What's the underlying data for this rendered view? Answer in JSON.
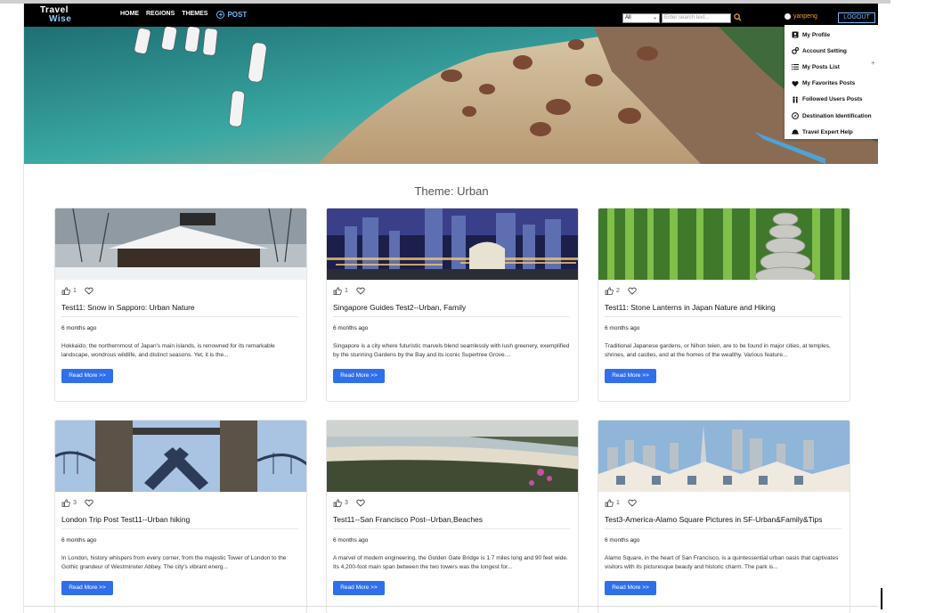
{
  "nav": {
    "logo_line1": "Travel",
    "logo_line2": "Wise",
    "links": [
      "HOME",
      "REGIONS",
      "THEMES"
    ],
    "post_label": "POST",
    "select_value": "All",
    "search_placeholder": "Enter search text...",
    "username": "yanpeng",
    "logout_label": "LOGOUT"
  },
  "user_menu": [
    {
      "label": "My Profile",
      "icon": "profile-icon"
    },
    {
      "label": "Account Setting",
      "icon": "gears-icon"
    },
    {
      "label": "My Posts List",
      "icon": "list-icon"
    },
    {
      "label": "My Favorites Posts",
      "icon": "heart-icon"
    },
    {
      "label": "Followed Users Posts",
      "icon": "followed-users-icon"
    },
    {
      "label": "Destination Identification",
      "icon": "compass-icon"
    },
    {
      "label": "Travel Expert Help",
      "icon": "expert-hat-icon"
    }
  ],
  "page_title": "Theme: Urban",
  "read_more_label": "Read More >>",
  "cards": [
    {
      "likes": "1",
      "title": "Test11: Snow in Sapporo: Urban Nature",
      "time": "6 months ago",
      "desc": "Hokkaido, the northernmost of Japan's main islands, is renowned for its remarkable landscape, wondrous wildlife, and distinct seasons. Yet, it is the...",
      "image": "snowy-house"
    },
    {
      "likes": "1",
      "title": "Singapore Guides Test2--Urban, Family",
      "time": "6 months ago",
      "desc": "Singapore is a city where futuristic marvels blend seamlessly with lush greenery, exemplified by the stunning Gardens by the Bay and its iconic Supertree Grove....",
      "image": "night-city"
    },
    {
      "likes": "2",
      "title": "Test11: Stone Lanterns in Japan Nature and Hiking",
      "time": "6 months ago",
      "desc": "Traditional Japanese gardens, or Nihon teien, are to be found in major cities, at temples, shrines, and castles, and at the homes of the wealthy. Various feature...",
      "image": "bamboo-stones"
    },
    {
      "likes": "3",
      "title": "London Trip Post Test11--Urban hiking",
      "time": "6 months ago",
      "desc": "In London, history whispers from every corner, from the majestic Tower of London to the Gothic grandeur of Westminster Abbey. The city's vibrant energ...",
      "image": "tower-bridge"
    },
    {
      "likes": "3",
      "title": "Test11--San Francisco Post--Urban,Beaches",
      "time": "6 months ago",
      "desc": "A marvel of modern engineering, the Golden Gate Bridge is 1.7 miles long and 90 feet wide. Its 4,200-foot main span between the two towers was the longest for...",
      "image": "beach-cliff"
    },
    {
      "likes": "1",
      "title": "Test3-America-Alamo Square Pictures in SF-Urban&Family&Tips",
      "time": "6 months ago",
      "desc": "Alamo Square, in the heart of San Francisco, is a quintessential urban oasis that captivates visitors with its picturesque beauty and historic charm. The park is...",
      "image": "sf-houses"
    }
  ],
  "colors": {
    "accent": "#2f6fec",
    "nav_bg": "#000000",
    "username": "#f0a030",
    "nav_link_blue": "#6fb7ff"
  }
}
